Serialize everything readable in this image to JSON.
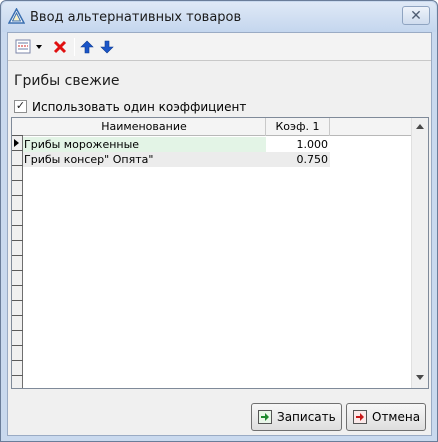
{
  "window": {
    "title": "Ввод альтернативных товаров",
    "close_glyph": "✕"
  },
  "toolbar": {
    "items": [
      {
        "name": "list-menu-icon",
        "color": "#cc2222"
      },
      {
        "name": "delete-icon",
        "color": "#e01010"
      },
      {
        "name": "move-up-icon",
        "color": "#1a55c8"
      },
      {
        "name": "move-down-icon",
        "color": "#1a55c8"
      }
    ]
  },
  "group": {
    "title": "Грибы свежие"
  },
  "options": {
    "use_single_coef_label": "Использовать один коэффициент",
    "use_single_coef_checked": true,
    "check_glyph": "✓"
  },
  "grid": {
    "columns": [
      "Наименование",
      "Коэф. 1"
    ],
    "rows": [
      {
        "name": "Грибы мороженные",
        "coef": "1.000",
        "selected": true
      },
      {
        "name": "Грибы консер\" Опята\"",
        "coef": "0.750",
        "selected": false
      }
    ],
    "selected_row_color": "#e3f4e6",
    "alt_row_color": "#ececec"
  },
  "buttons": {
    "save_label": "Записать",
    "cancel_label": "Отмена"
  }
}
